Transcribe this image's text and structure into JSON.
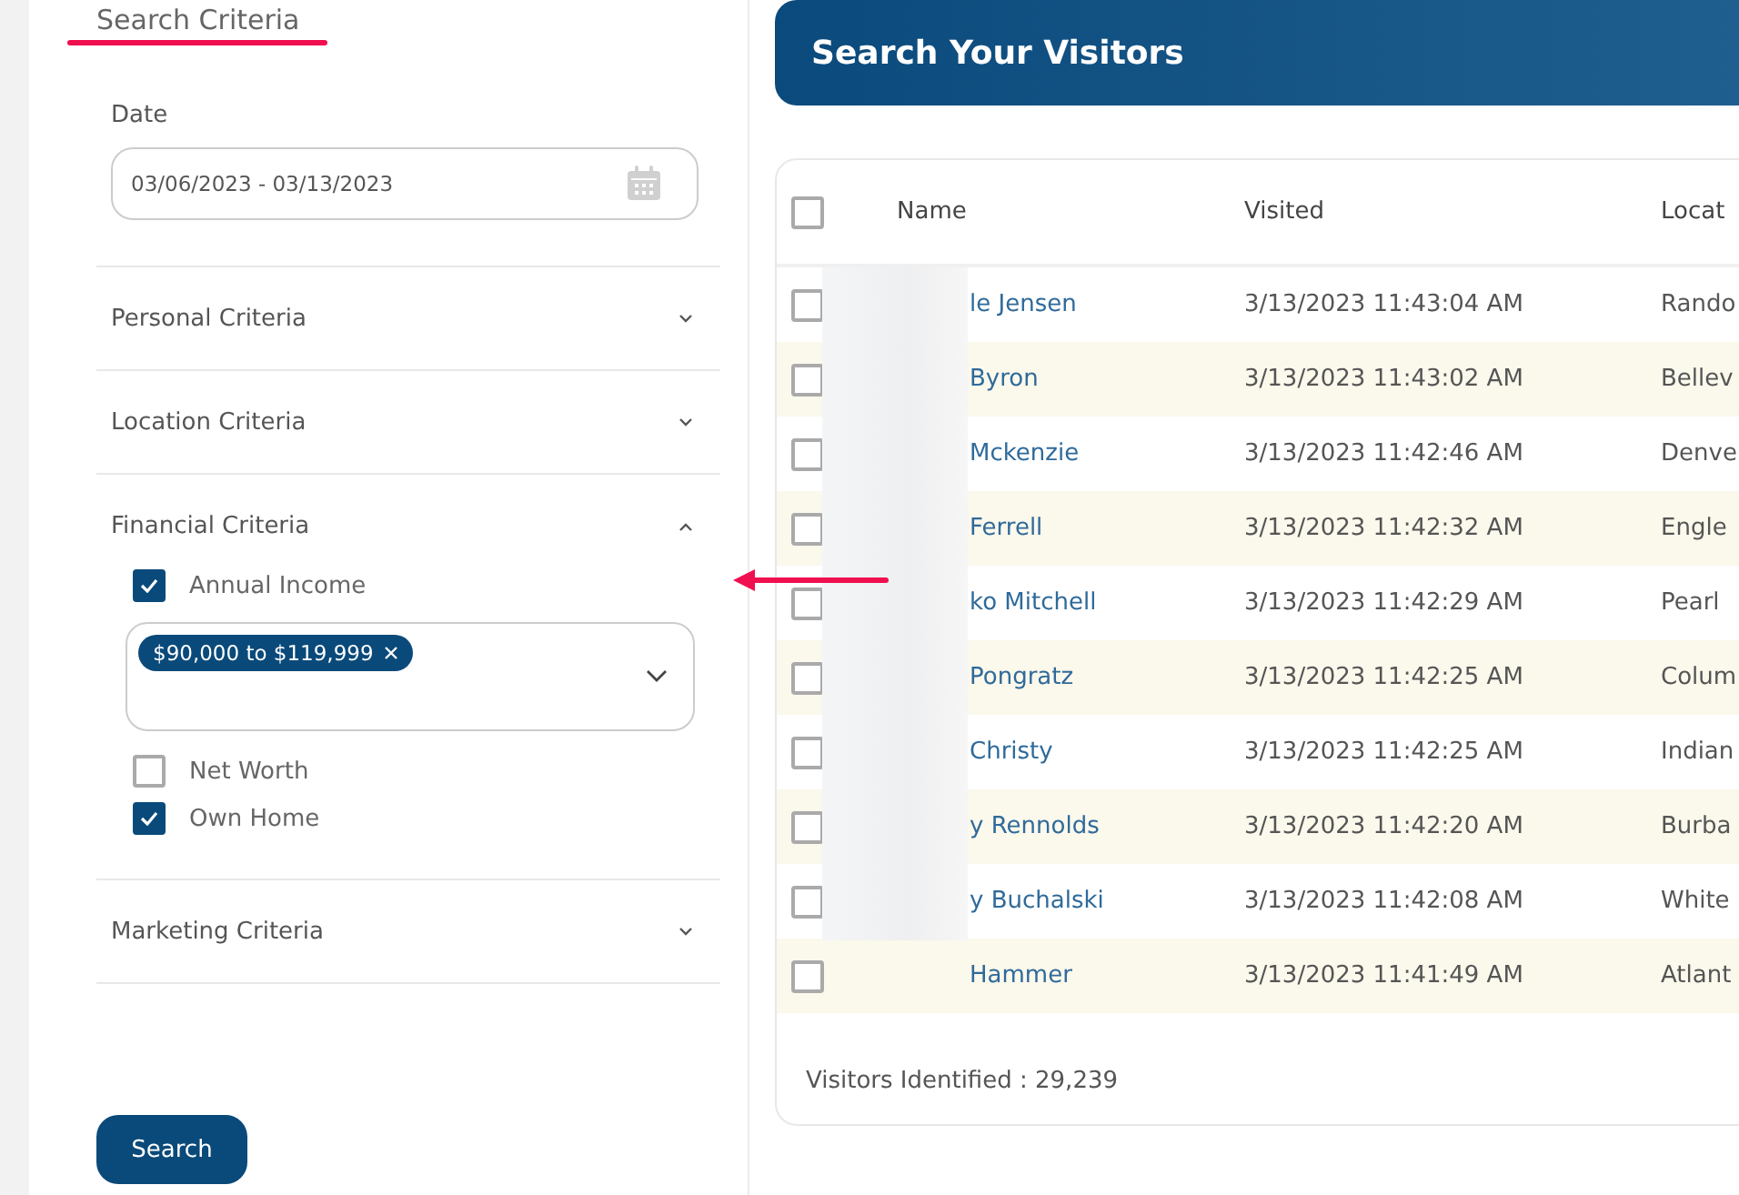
{
  "sidebar": {
    "title": "Search Criteria",
    "date": {
      "label": "Date",
      "value": "03/06/2023 - 03/13/2023"
    },
    "sections": [
      {
        "title": "Personal Criteria",
        "expanded": false
      },
      {
        "title": "Location Criteria",
        "expanded": false
      },
      {
        "title": "Financial Criteria",
        "expanded": true,
        "options": [
          {
            "label": "Annual Income",
            "checked": true,
            "tags": [
              "$90,000 to $119,999"
            ]
          },
          {
            "label": "Net Worth",
            "checked": false
          },
          {
            "label": "Own Home",
            "checked": true
          }
        ]
      },
      {
        "title": "Marketing Criteria",
        "expanded": false
      }
    ],
    "search_button": "Search"
  },
  "main": {
    "title": "Search Your Visitors",
    "table": {
      "select_all": false,
      "columns": [
        "Name",
        "Visited",
        "Locat"
      ],
      "rows": [
        {
          "checked": false,
          "name": "le Jensen",
          "visited": "3/13/2023 11:43:04 AM",
          "location": "Rando"
        },
        {
          "checked": false,
          "name": "Byron",
          "visited": "3/13/2023 11:43:02 AM",
          "location": "Bellev"
        },
        {
          "checked": false,
          "name": "Mckenzie",
          "visited": "3/13/2023 11:42:46 AM",
          "location": "Denve"
        },
        {
          "checked": false,
          "name": "Ferrell",
          "visited": "3/13/2023 11:42:32 AM",
          "location": "Engle"
        },
        {
          "checked": false,
          "name": "ko Mitchell",
          "visited": "3/13/2023 11:42:29 AM",
          "location": "Pearl"
        },
        {
          "checked": false,
          "name": "Pongratz",
          "visited": "3/13/2023 11:42:25 AM",
          "location": "Colum"
        },
        {
          "checked": false,
          "name": "Christy",
          "visited": "3/13/2023 11:42:25 AM",
          "location": "Indian"
        },
        {
          "checked": false,
          "name": "y Rennolds",
          "visited": "3/13/2023 11:42:20 AM",
          "location": "Burba"
        },
        {
          "checked": false,
          "name": "y Buchalski",
          "visited": "3/13/2023 11:42:08 AM",
          "location": "White"
        },
        {
          "checked": false,
          "name": "Hammer",
          "visited": "3/13/2023 11:41:49 AM",
          "location": "Atlant"
        }
      ]
    },
    "footer": "Visitors Identified : 29,239"
  }
}
